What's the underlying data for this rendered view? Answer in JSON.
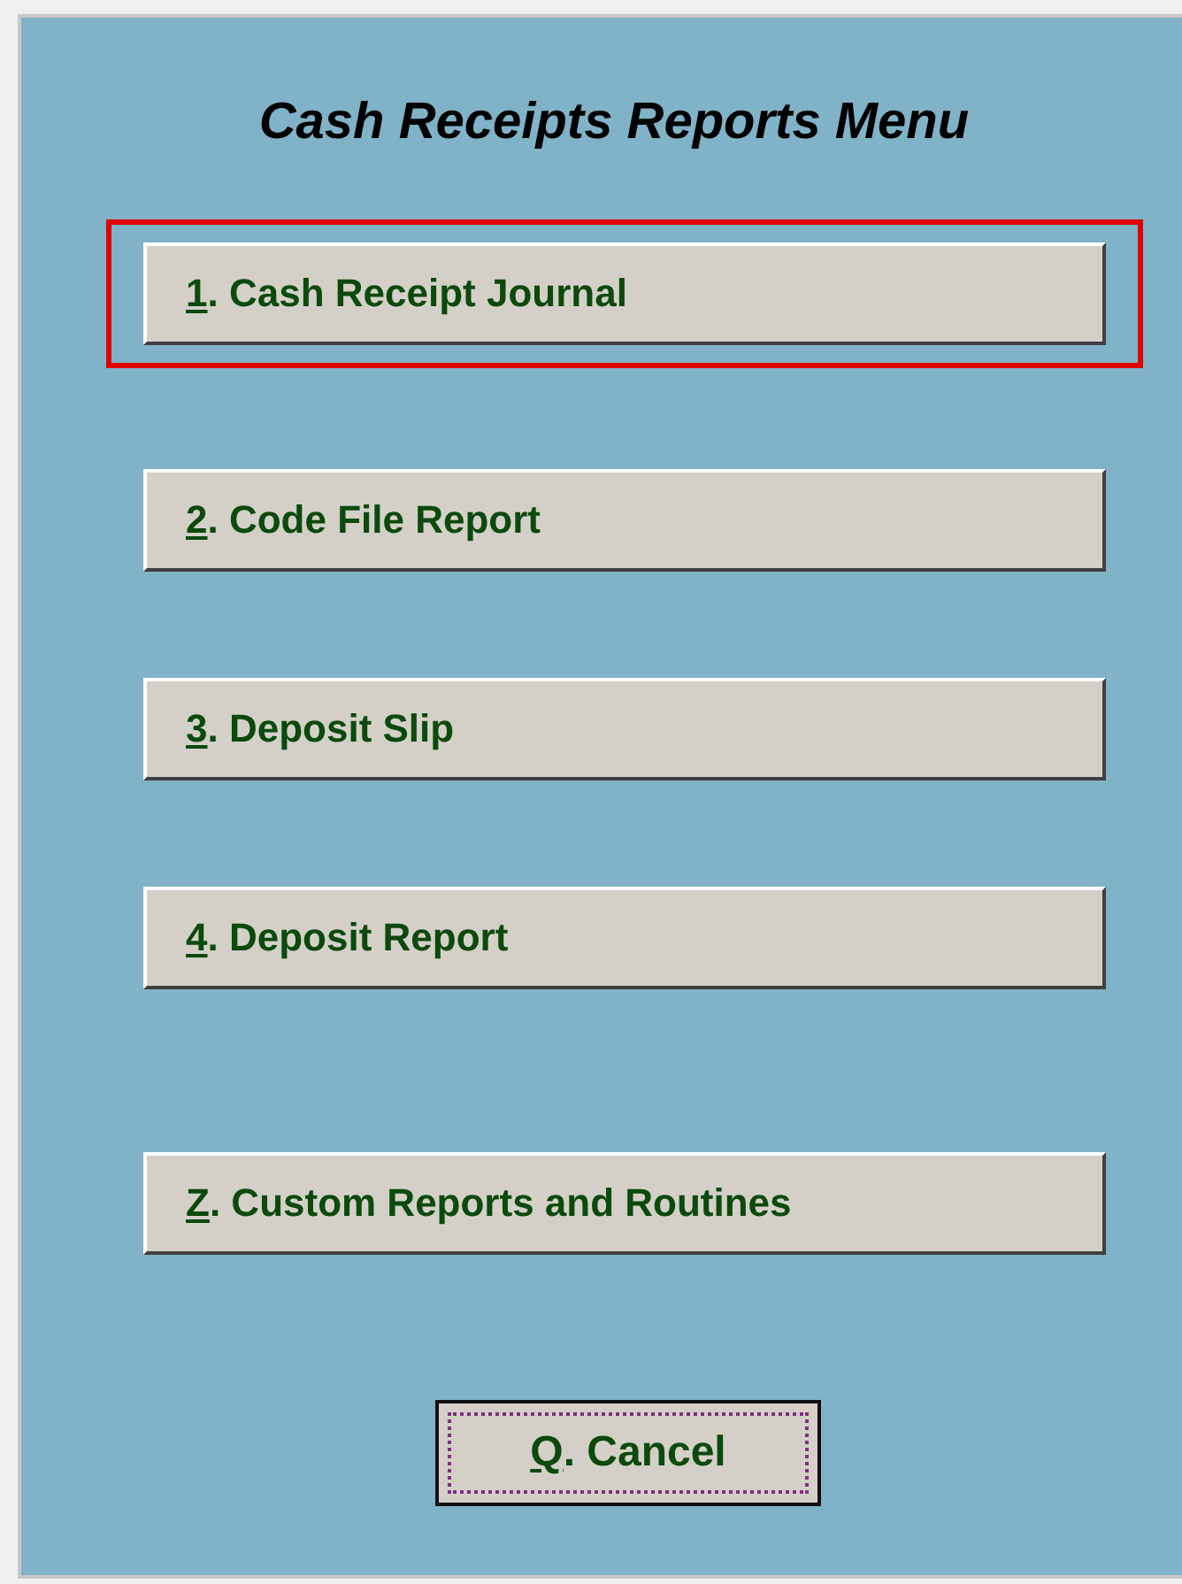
{
  "window": {
    "title": "Cash Receipts Reports Menu"
  },
  "menu_items": [
    {
      "hotkey": "1",
      "text": ". Cash Receipt Journal",
      "highlighted": true
    },
    {
      "hotkey": "2",
      "text": ". Code File Report",
      "highlighted": false
    },
    {
      "hotkey": "3",
      "text": ". Deposit Slip",
      "highlighted": false
    },
    {
      "hotkey": "4",
      "text": ". Deposit Report",
      "highlighted": false
    },
    {
      "hotkey": "Z",
      "text": ". Custom Reports and Routines",
      "highlighted": false
    }
  ],
  "cancel_button": {
    "hotkey": "Q",
    "text": ". Cancel",
    "focused": true
  }
}
